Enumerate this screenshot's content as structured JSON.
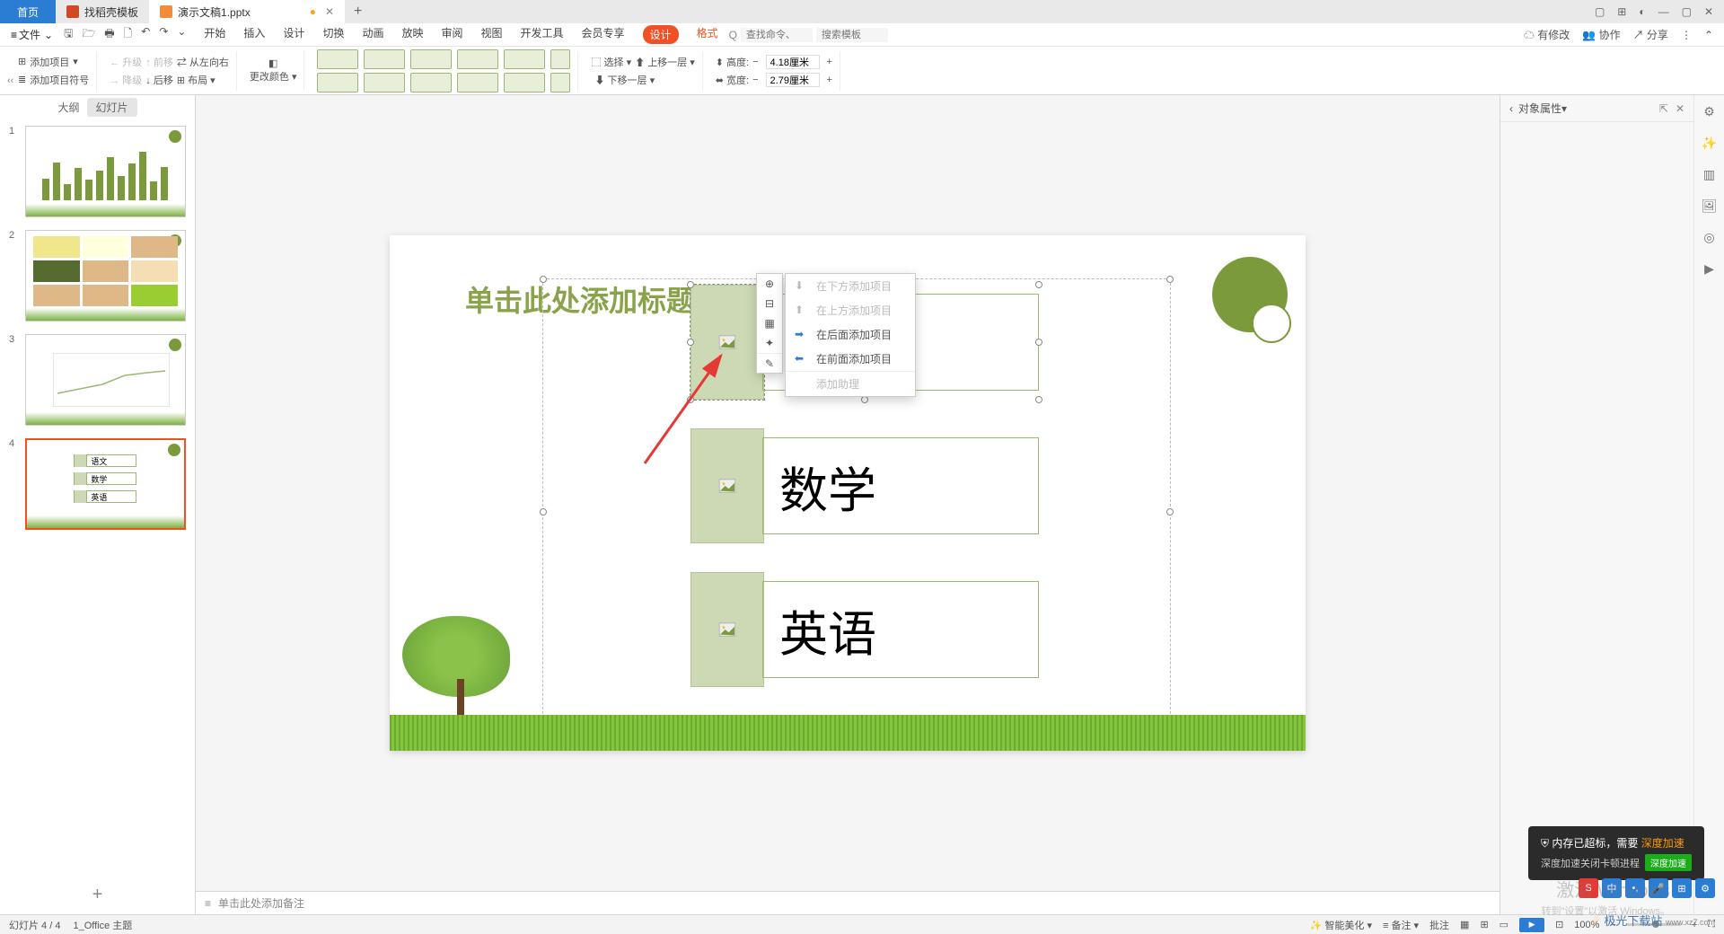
{
  "titlebar": {
    "home": "首页",
    "tab1": "找稻壳模板",
    "tab2": "演示文稿1.pptx",
    "dirty": "●",
    "plus": "+",
    "win": [
      "▢",
      "⊞",
      "◐",
      "—",
      "▢",
      "✕"
    ]
  },
  "menubar": {
    "file": "文件",
    "tabs": [
      "开始",
      "插入",
      "设计",
      "切换",
      "动画",
      "放映",
      "审阅",
      "视图",
      "开发工具",
      "会员专享",
      "设计",
      "格式"
    ],
    "search_icon": "Q",
    "search1": "查找命令、",
    "search2": "搜索模板",
    "right": {
      "modified": "有修改",
      "collab": "协作",
      "share": "分享"
    }
  },
  "ribbon": {
    "add_item": "添加项目",
    "add_bullet": "添加项目符号",
    "upgrade": "升级",
    "forward": "前移",
    "ltr": "从左向右",
    "downgrade": "降级",
    "backward": "后移",
    "layout": "布局",
    "change_color": "更改颜色",
    "select": "选择",
    "up_layer": "上移一层",
    "down_layer": "下移一层",
    "height": "高度:",
    "width": "宽度:",
    "h_val": "4.18厘米",
    "w_val": "2.79厘米"
  },
  "leftpanel": {
    "outline": "大纲",
    "slides": "幻灯片",
    "collapse": "‹‹",
    "thumb4_items": [
      "语文",
      "数学",
      "英语"
    ]
  },
  "context": {
    "items": [
      {
        "label": "在下方添加项目",
        "disabled": true
      },
      {
        "label": "在上方添加项目",
        "disabled": true
      },
      {
        "label": "在后面添加项目",
        "disabled": false
      },
      {
        "label": "在前面添加项目",
        "disabled": false
      },
      {
        "label": "添加助理",
        "disabled": true
      }
    ]
  },
  "slide": {
    "title": "单击此处添加标题",
    "item2": "数学",
    "item3": "英语"
  },
  "rightpanel": {
    "title": "对象属性"
  },
  "notes": {
    "placeholder": "单击此处添加备注"
  },
  "statusbar": {
    "slide": "幻灯片 4 / 4",
    "theme": "1_Office 主题",
    "smart": "智能美化",
    "backup": "备注",
    "comment": "批注",
    "zoom": "100%"
  },
  "toast": {
    "line1_a": "内存已超标，需要",
    "line1_b": "深度加速",
    "line2": "深度加速关闭卡顿进程",
    "btn": "深度加速"
  },
  "watermark": {
    "l1": "激活 Windows",
    "l2": "转到\"设置\"以激活 Windows。",
    "site": "极光下载站"
  },
  "ime": [
    "S",
    "中",
    "•,",
    "🎤",
    "⊞",
    "⚙"
  ]
}
